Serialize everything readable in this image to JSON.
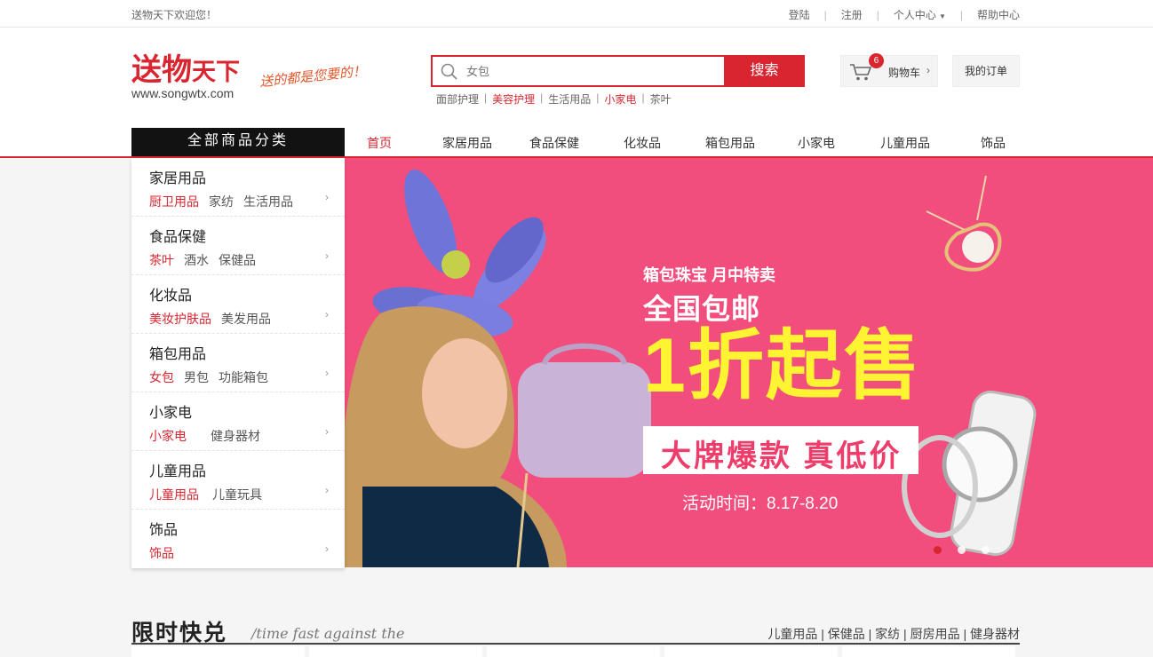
{
  "topbar": {
    "welcome": "送物天下欢迎您！",
    "links": [
      "登陆",
      "注册",
      "个人中心",
      "帮助中心"
    ]
  },
  "logo": {
    "name_main": "送物",
    "name_small": "天下",
    "url": "www.songwtx.com",
    "slogan": "送的都是您要的！"
  },
  "search": {
    "placeholder": "女包",
    "button_label": "搜索",
    "hot_keywords": [
      "面部护理",
      "美容护理",
      "生活用品",
      "小家电",
      "茶叶"
    ]
  },
  "cart": {
    "count": "6",
    "label": "购物车"
  },
  "orders_label": "我的订单",
  "nav": {
    "all_categories": "全部商品分类",
    "items": [
      "首页",
      "家居用品",
      "食品保健",
      "化妆品",
      "箱包用品",
      "小家电",
      "儿童用品",
      "饰品"
    ],
    "active_index": 0
  },
  "categories": [
    {
      "name": "家居用品",
      "subs": [
        "厨卫用品",
        "家纺",
        "生活用品"
      ]
    },
    {
      "name": "食品保健",
      "subs": [
        "茶叶",
        "酒水",
        "保健品"
      ]
    },
    {
      "name": "化妆品",
      "subs": [
        "美妆护肤品",
        "美发用品"
      ]
    },
    {
      "name": "箱包用品",
      "subs": [
        "女包",
        "男包",
        "功能箱包"
      ]
    },
    {
      "name": "小家电",
      "subs": [
        "小家电",
        "健身器材"
      ]
    },
    {
      "name": "儿童用品",
      "subs": [
        "儿童用品",
        "儿童玩具"
      ]
    },
    {
      "name": "饰品",
      "subs": [
        "饰品"
      ]
    }
  ],
  "banner": {
    "line1": "箱包珠宝 月中特卖",
    "line2": "全国包邮",
    "line3": "1折起售",
    "line4": "大牌爆款 真低价",
    "line5": "活动时间：8.17-8.20",
    "slides": 3,
    "active_slide": 0
  },
  "section": {
    "title": "限时快兑",
    "subtitle": "/time fast against the",
    "tags": "儿童用品 | 保健品 | 家纺 | 厨房用品 | 健身器材"
  },
  "colors": {
    "brand_red": "#d9252f",
    "banner_pink": "#f24e7d",
    "headline_yellow": "#fff432"
  }
}
